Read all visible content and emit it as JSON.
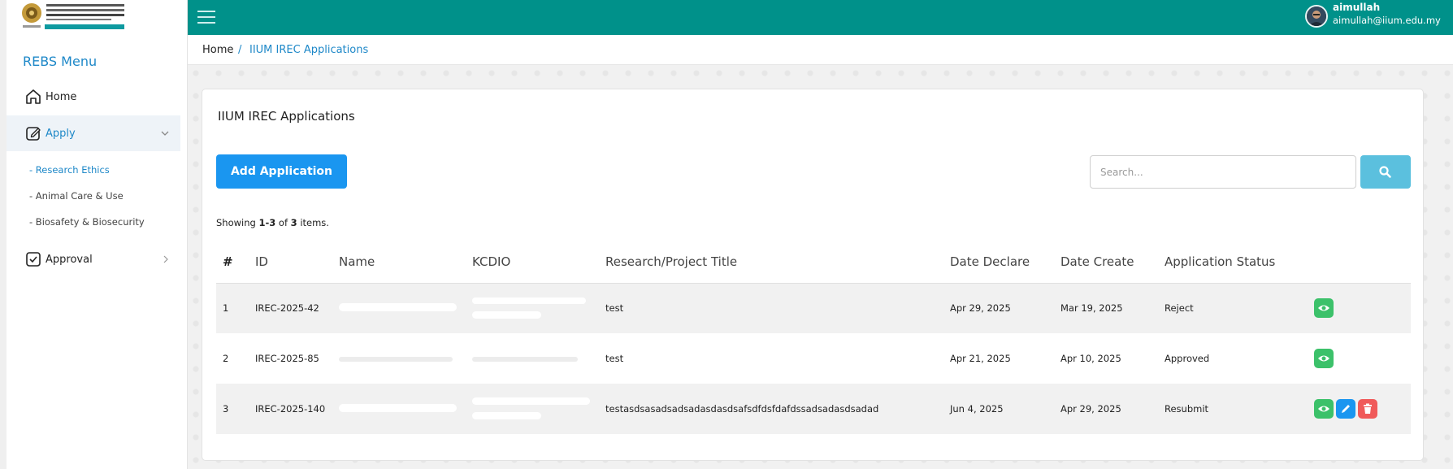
{
  "sidebar": {
    "menu_title": "REBS Menu",
    "items": [
      {
        "label": "Home",
        "icon": "home-icon"
      },
      {
        "label": "Apply",
        "icon": "edit-square-icon",
        "active": true
      },
      {
        "label": "Approval",
        "icon": "checkbox-icon"
      }
    ],
    "sub_items": [
      {
        "label": "- Research Ethics",
        "active": true
      },
      {
        "label": "- Animal Care & Use"
      },
      {
        "label": "- Biosafety & Biosecurity"
      }
    ]
  },
  "topbar": {
    "color": "#00918a",
    "user_name": "aimullah",
    "user_email": "aimullah@iium.edu.my"
  },
  "breadcrumb": {
    "home": "Home",
    "separator": "/",
    "current": "IIUM IREC Applications"
  },
  "main": {
    "title": "IIUM IREC Applications",
    "add_button": "Add Application",
    "search_placeholder": "Search...",
    "summary_prefix": "Showing ",
    "summary_range": "1-3",
    "summary_mid": " of ",
    "summary_total": "3",
    "summary_suffix": " items."
  },
  "table": {
    "headers": [
      "#",
      "ID",
      "Name",
      "KCDIO",
      "Research/Project Title",
      "Date Declare",
      "Date Create",
      "Application Status",
      ""
    ],
    "rows": [
      {
        "num": "1",
        "id": "IREC-2025-42",
        "title": "test",
        "date_declare": "Apr 29, 2025",
        "date_create": "Mar 19, 2025",
        "status": "Reject",
        "actions": [
          "view"
        ]
      },
      {
        "num": "2",
        "id": "IREC-2025-85",
        "title": "test",
        "date_declare": "Apr 21, 2025",
        "date_create": "Apr 10, 2025",
        "status": "Approved",
        "actions": [
          "view"
        ]
      },
      {
        "num": "3",
        "id": "IREC-2025-140",
        "title": "testasdsasadsadsadasdasdsafsdfdsfdafdssadsadasdsadad",
        "date_declare": "Jun 4, 2025",
        "date_create": "Apr 29, 2025",
        "status": "Resubmit",
        "actions": [
          "view",
          "edit",
          "delete"
        ]
      }
    ]
  },
  "colors": {
    "accent": "#1e88c8",
    "add_button": "#1a96f0",
    "search_button": "#5bc0de",
    "view": "#3cc16a",
    "edit": "#1a96f0",
    "delete": "#f05a5a"
  }
}
